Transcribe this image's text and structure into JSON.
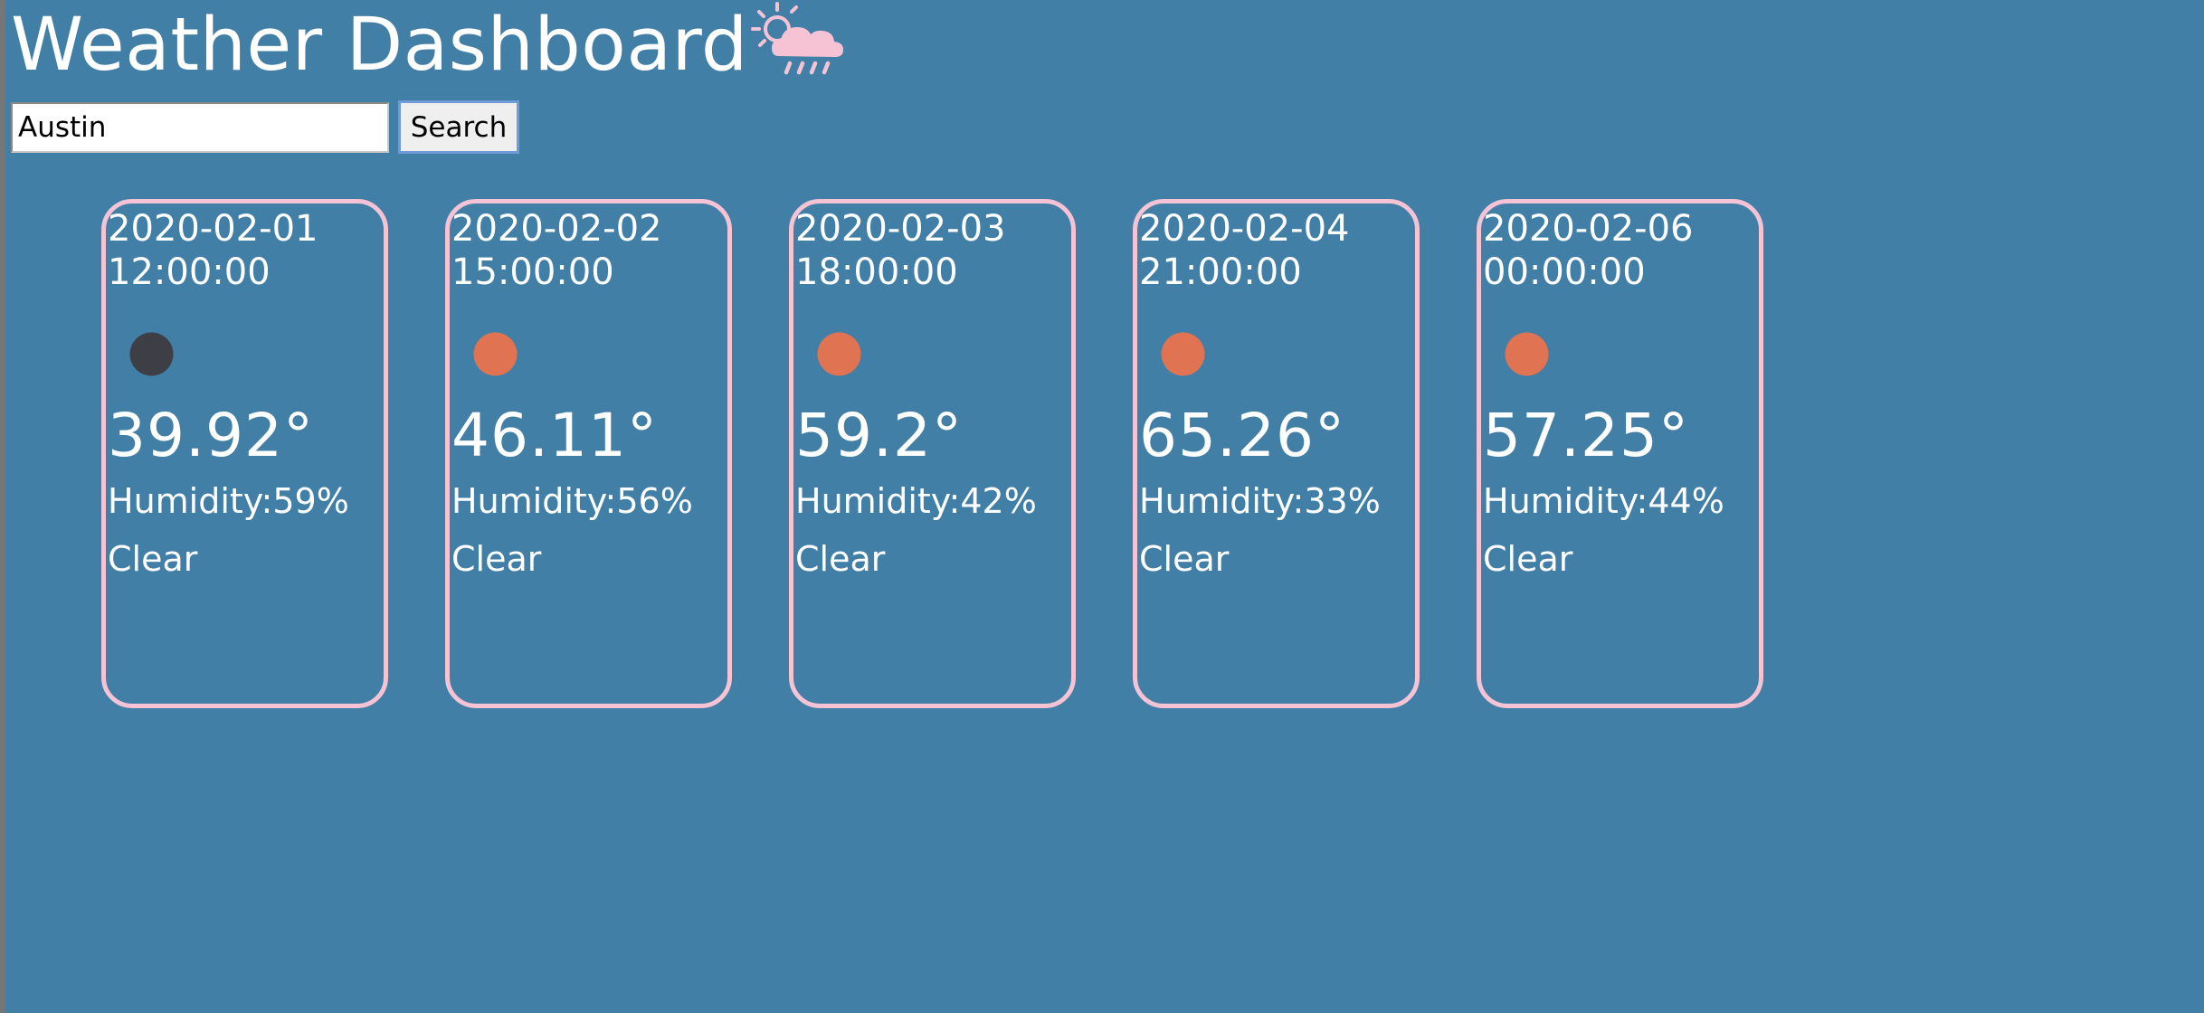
{
  "header": {
    "title": "Weather Dashboard",
    "title_icon": "sun-behind-rain-cloud-icon",
    "icon_color": "#f6c3d5"
  },
  "search": {
    "value": "Austin",
    "button_label": "Search"
  },
  "colors": {
    "background": "#427fa7",
    "card_border": "#f6c3d5",
    "text": "#ffffff",
    "night_icon": "#3d3f45",
    "sun_icon": "#e07352"
  },
  "forecast": [
    {
      "date": "2020-02-01",
      "time": "12:00:00",
      "icon": "moon-icon",
      "icon_color": "#3d3f45",
      "temp": "39.92°",
      "humidity": "Humidity:59%",
      "condition": "Clear"
    },
    {
      "date": "2020-02-02",
      "time": "15:00:00",
      "icon": "sun-icon",
      "icon_color": "#e07352",
      "temp": "46.11°",
      "humidity": "Humidity:56%",
      "condition": "Clear"
    },
    {
      "date": "2020-02-03",
      "time": "18:00:00",
      "icon": "sun-icon",
      "icon_color": "#e07352",
      "temp": "59.2°",
      "humidity": "Humidity:42%",
      "condition": "Clear"
    },
    {
      "date": "2020-02-04",
      "time": "21:00:00",
      "icon": "sun-icon",
      "icon_color": "#e07352",
      "temp": "65.26°",
      "humidity": "Humidity:33%",
      "condition": "Clear"
    },
    {
      "date": "2020-02-06",
      "time": "00:00:00",
      "icon": "sun-icon",
      "icon_color": "#e07352",
      "temp": "57.25°",
      "humidity": "Humidity:44%",
      "condition": "Clear"
    }
  ]
}
